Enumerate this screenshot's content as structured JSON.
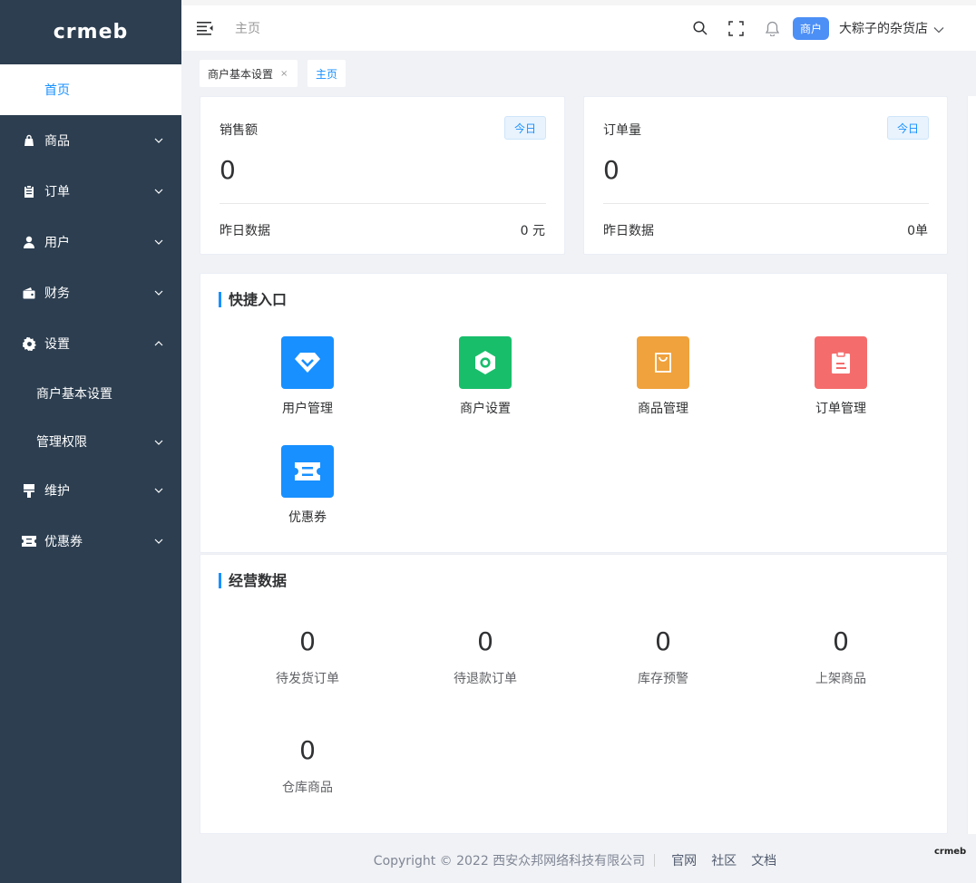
{
  "brand": {
    "logo_text": "crmeb",
    "mini_logo_text": "crmeb"
  },
  "sidebar": {
    "home": "首页",
    "items": [
      {
        "label": "商品",
        "icon": "bag-icon"
      },
      {
        "label": "订单",
        "icon": "clipboard-icon"
      },
      {
        "label": "用户",
        "icon": "user-icon"
      },
      {
        "label": "财务",
        "icon": "wallet-icon"
      },
      {
        "label": "设置",
        "icon": "gear-icon"
      },
      {
        "label": "维护",
        "icon": "brush-icon"
      },
      {
        "label": "优惠券",
        "icon": "ticket-icon"
      }
    ],
    "settings_sub": [
      "商户基本设置",
      "管理权限"
    ]
  },
  "topbar": {
    "breadcrumb": "主页",
    "merchant_badge": "商户",
    "shop_name": "大粽子的杂货店"
  },
  "tags": {
    "settings": "商户基本设置",
    "home": "主页"
  },
  "stats": [
    {
      "title": "销售额",
      "badge": "今日",
      "value": "0",
      "yesterday_label": "昨日数据",
      "yesterday_value": "0 元"
    },
    {
      "title": "订单量",
      "badge": "今日",
      "value": "0",
      "yesterday_label": "昨日数据",
      "yesterday_value": "0单"
    }
  ],
  "quick": {
    "title": "快捷入口",
    "items": [
      {
        "label": "用户管理",
        "color": "#1890ff",
        "icon": "diamond-icon"
      },
      {
        "label": "商户设置",
        "color": "#19be6b",
        "icon": "hexagon-icon"
      },
      {
        "label": "商品管理",
        "color": "#f0a23c",
        "icon": "shopping-bag-icon"
      },
      {
        "label": "订单管理",
        "color": "#f56c6c",
        "icon": "clipboard-icon"
      },
      {
        "label": "优惠券",
        "color": "#1890ff",
        "icon": "ticket-icon"
      }
    ]
  },
  "business": {
    "title": "经营数据",
    "metrics": [
      {
        "value": "0",
        "label": "待发货订单"
      },
      {
        "value": "0",
        "label": "待退款订单"
      },
      {
        "value": "0",
        "label": "库存预警"
      },
      {
        "value": "0",
        "label": "上架商品"
      },
      {
        "value": "0",
        "label": "仓库商品"
      }
    ]
  },
  "footer": {
    "copyright": "Copyright © 2022 西安众邦网络科技有限公司",
    "links": [
      "官网",
      "社区",
      "文档"
    ]
  },
  "colors": {
    "sidebar_bg": "#2c3e50",
    "accent": "#1890ff"
  }
}
